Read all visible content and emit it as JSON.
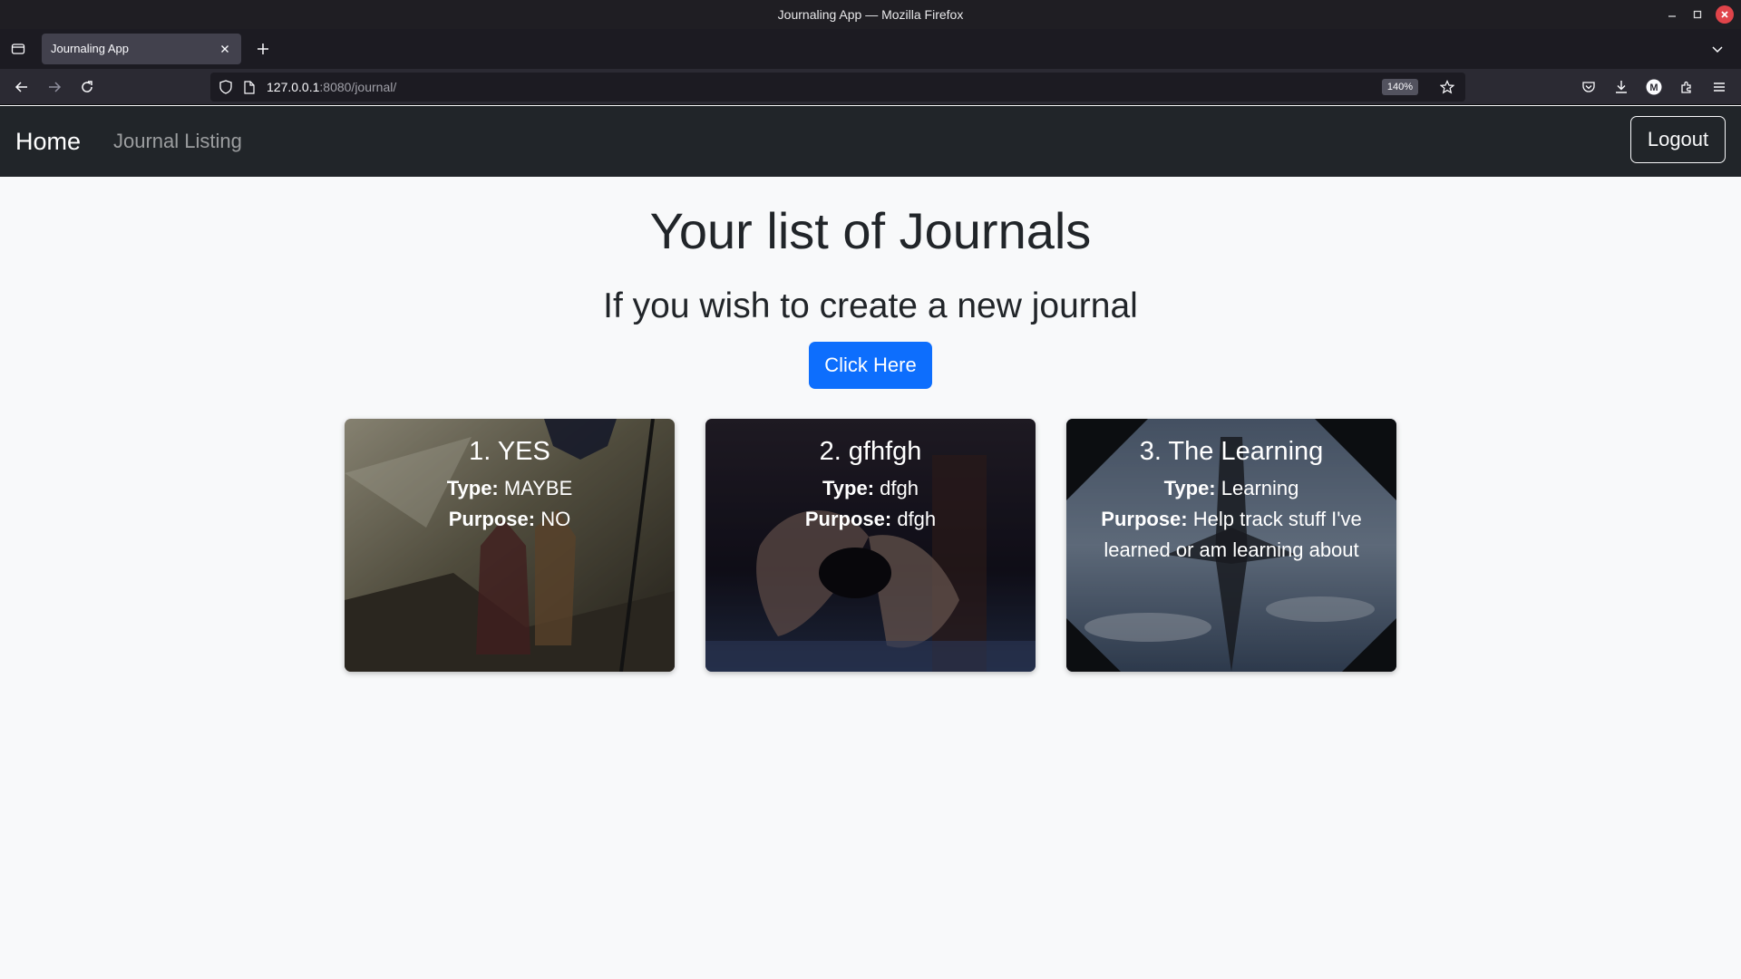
{
  "window": {
    "title": "Journaling App — Mozilla Firefox"
  },
  "browser": {
    "tab_title": "Journaling App",
    "url_host": "127.0.0.1",
    "url_rest": ":8080/journal/",
    "zoom": "140%"
  },
  "nav": {
    "brand": "Home",
    "link": "Journal Listing",
    "logout": "Logout"
  },
  "main": {
    "title": "Your list of Journals",
    "subtitle": "If you wish to create a new journal",
    "cta": "Click Here"
  },
  "labels": {
    "type": "Type:",
    "purpose": "Purpose:"
  },
  "journals": [
    {
      "title": "1. YES",
      "type": "MAYBE",
      "purpose": "NO"
    },
    {
      "title": "2. gfhfgh",
      "type": "dfgh",
      "purpose": "dfgh"
    },
    {
      "title": "3. The Learning",
      "type": "Learning",
      "purpose": "Help track stuff I've learned or am learning about"
    }
  ],
  "colors": {
    "navbar": "#212529",
    "primary": "#0d6efd",
    "page_bg": "#f8f9fa"
  }
}
